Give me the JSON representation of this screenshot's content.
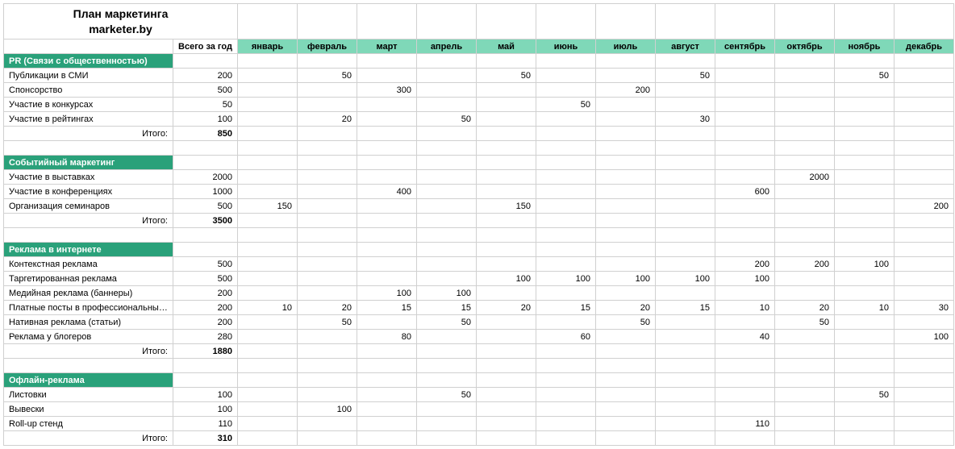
{
  "title_line1": "План маркетинга",
  "title_line2": "marketer.by",
  "header_total": "Всего за год",
  "months": [
    "январь",
    "февраль",
    "март",
    "апрель",
    "май",
    "июнь",
    "июль",
    "август",
    "сентябрь",
    "октябрь",
    "ноябрь",
    "декабрь"
  ],
  "itogo_label": "Итого:",
  "sections": [
    {
      "name": "PR (Связи с общественностью)",
      "rows": [
        {
          "label": "Публикации в СМИ",
          "total": 200,
          "m": [
            null,
            50,
            null,
            null,
            50,
            null,
            null,
            50,
            null,
            null,
            50,
            null
          ]
        },
        {
          "label": "Спонсорство",
          "total": 500,
          "m": [
            null,
            null,
            300,
            null,
            null,
            null,
            200,
            null,
            null,
            null,
            null,
            null
          ]
        },
        {
          "label": "Участие в конкурсах",
          "total": 50,
          "m": [
            null,
            null,
            null,
            null,
            null,
            50,
            null,
            null,
            null,
            null,
            null,
            null
          ]
        },
        {
          "label": "Участие в рейтингах",
          "total": 100,
          "m": [
            null,
            20,
            null,
            50,
            null,
            null,
            null,
            30,
            null,
            null,
            null,
            null
          ]
        }
      ],
      "subtotal": 850
    },
    {
      "name": "Событийный маркетинг",
      "rows": [
        {
          "label": "Участие в выставках",
          "total": 2000,
          "m": [
            null,
            null,
            null,
            null,
            null,
            null,
            null,
            null,
            null,
            2000,
            null,
            null
          ]
        },
        {
          "label": "Участие в конференциях",
          "total": 1000,
          "m": [
            null,
            null,
            400,
            null,
            null,
            null,
            null,
            null,
            600,
            null,
            null,
            null
          ]
        },
        {
          "label": "Организация семинаров",
          "total": 500,
          "m": [
            150,
            null,
            null,
            null,
            150,
            null,
            null,
            null,
            null,
            null,
            null,
            200
          ]
        }
      ],
      "subtotal": 3500
    },
    {
      "name": "Реклама в интернете",
      "rows": [
        {
          "label": "Контекстная реклама",
          "total": 500,
          "m": [
            null,
            null,
            null,
            null,
            null,
            null,
            null,
            null,
            200,
            200,
            100,
            null
          ]
        },
        {
          "label": "Таргетированная реклама",
          "total": 500,
          "m": [
            null,
            null,
            null,
            null,
            100,
            100,
            100,
            100,
            100,
            null,
            null,
            null
          ]
        },
        {
          "label": "Медийная реклама (баннеры)",
          "total": 200,
          "m": [
            null,
            null,
            100,
            100,
            null,
            null,
            null,
            null,
            null,
            null,
            null,
            null
          ]
        },
        {
          "label": "Платные посты в профессиональных сообществах",
          "total": 200,
          "m": [
            10,
            20,
            15,
            15,
            20,
            15,
            20,
            15,
            10,
            20,
            10,
            30
          ]
        },
        {
          "label": "Нативная реклама (статьи)",
          "total": 200,
          "m": [
            null,
            50,
            null,
            50,
            null,
            null,
            50,
            null,
            null,
            50,
            null,
            null
          ]
        },
        {
          "label": "Реклама у блогеров",
          "total": 280,
          "m": [
            null,
            null,
            80,
            null,
            null,
            60,
            null,
            null,
            40,
            null,
            null,
            100
          ]
        }
      ],
      "subtotal": 1880
    },
    {
      "name": "Офлайн-реклама",
      "rows": [
        {
          "label": "Листовки",
          "total": 100,
          "m": [
            null,
            null,
            null,
            50,
            null,
            null,
            null,
            null,
            null,
            null,
            50,
            null
          ]
        },
        {
          "label": "Вывески",
          "total": 100,
          "m": [
            null,
            100,
            null,
            null,
            null,
            null,
            null,
            null,
            null,
            null,
            null,
            null
          ]
        },
        {
          "label": "Roll-up стенд",
          "total": 110,
          "m": [
            null,
            null,
            null,
            null,
            null,
            null,
            null,
            null,
            110,
            null,
            null,
            null
          ]
        }
      ],
      "subtotal": 310
    }
  ]
}
